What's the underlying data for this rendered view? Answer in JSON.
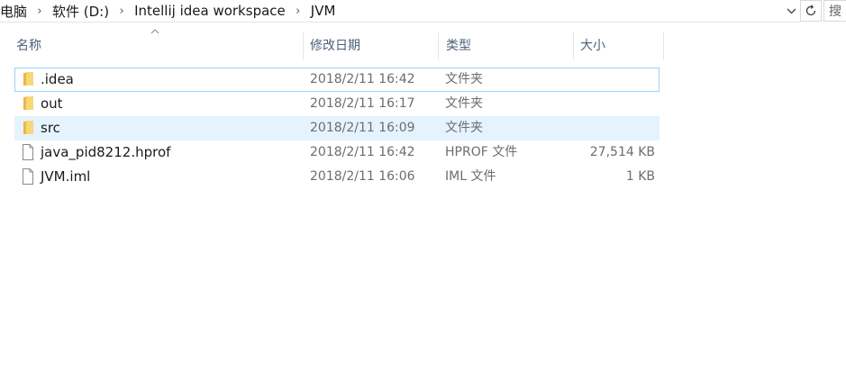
{
  "address": {
    "crumbs": [
      "电脑",
      "软件 (D:)",
      "Intellij idea workspace",
      "JVM"
    ],
    "separator": "›",
    "search_placeholder": "搜"
  },
  "columns": {
    "name": "名称",
    "date": "修改日期",
    "type": "类型",
    "size": "大小"
  },
  "files": [
    {
      "name": ".idea",
      "date": "2018/2/11 16:42",
      "type": "文件夹",
      "size": "",
      "icon": "folder-icon"
    },
    {
      "name": "out",
      "date": "2018/2/11 16:17",
      "type": "文件夹",
      "size": "",
      "icon": "folder-icon"
    },
    {
      "name": "src",
      "date": "2018/2/11 16:09",
      "type": "文件夹",
      "size": "",
      "icon": "folder-icon"
    },
    {
      "name": "java_pid8212.hprof",
      "date": "2018/2/11 16:42",
      "type": "HPROF 文件",
      "size": "27,514 KB",
      "icon": "file-icon"
    },
    {
      "name": "JVM.iml",
      "date": "2018/2/11 16:06",
      "type": "IML 文件",
      "size": "1 KB",
      "icon": "file-icon"
    }
  ],
  "colors": {
    "folder": "#f8d775",
    "selection_border": "#99d1ff",
    "hover_bg": "#e5f3ff"
  }
}
